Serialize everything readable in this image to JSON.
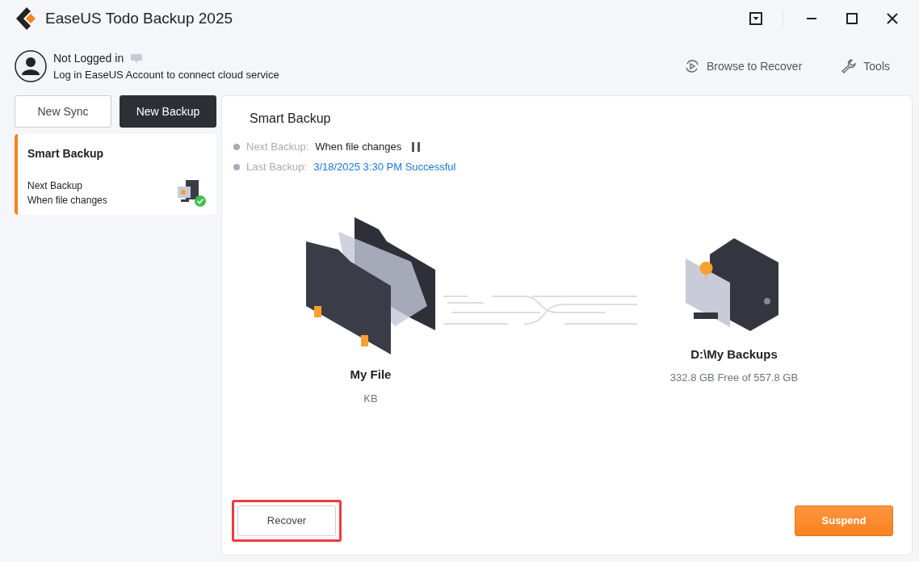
{
  "window": {
    "title": "EaseUS Todo Backup 2025"
  },
  "account": {
    "name": "Not Logged in",
    "hint": "Log in EaseUS Account to connect cloud service"
  },
  "toolbar": [
    {
      "label": "Browse to Recover",
      "kind": "browse"
    },
    {
      "label": "Tools",
      "kind": "tools"
    }
  ],
  "sidebar": {
    "buttons": [
      {
        "label": "New Sync",
        "kind": "outline"
      },
      {
        "label": "New Backup",
        "kind": "dark"
      }
    ],
    "tasks": [
      {
        "title": "Smart Backup",
        "schedule_label": "Next Backup",
        "schedule": "When file changes",
        "selected": true
      }
    ]
  },
  "detail": {
    "title": "Smart Backup",
    "info": [
      {
        "label": "Next Backup:",
        "value": "When file changes",
        "kind": "schedule"
      },
      {
        "label": "Last Backup:",
        "value": "3/18/2025 3:30 PM Successful",
        "kind": "status"
      }
    ],
    "source": {
      "name": "My File",
      "size": "KB"
    },
    "target": {
      "name": "D:\\My Backups",
      "space": "332.8 GB Free of 557.8 GB"
    },
    "buttons": [
      {
        "label": "Recover",
        "kind": "outline",
        "highlighted": true
      },
      {
        "label": "Suspend",
        "kind": "primary",
        "highlighted": false
      }
    ]
  }
}
